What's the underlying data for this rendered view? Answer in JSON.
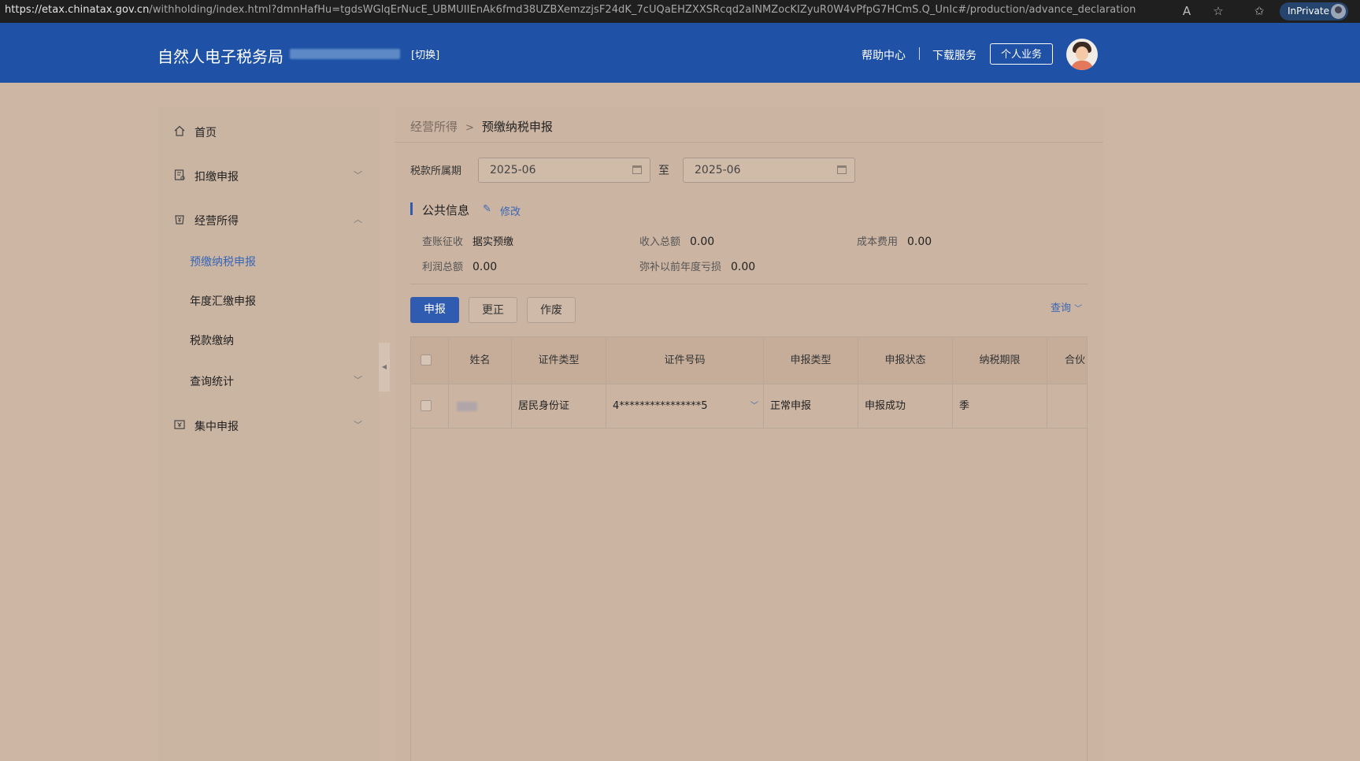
{
  "browser": {
    "url_host": "https://etax.chinatax.gov.cn",
    "url_path": "/withholding/index.html?dmnHafHu=tgdsWGlqErNucE_UBMUIIEnAk6fmd38UZBXemzzjsF24dK_7cUQaEHZXXSRcqd2aINMZocKIZyuR0W4vPfpG7HCmS.Q_UnIc#/production/advance_declaration",
    "inprivate_label": "InPrivate",
    "icons": [
      "read-aloud-icon",
      "star-icon",
      "favorites-icon"
    ]
  },
  "header": {
    "brand": "自然人电子税务局",
    "switch_label": "[切换]",
    "help": "帮助中心",
    "download": "下载服务",
    "personal": "个人业务"
  },
  "sidebar": {
    "items": [
      {
        "label": "首页",
        "icon": "home-icon"
      },
      {
        "label": "扣缴申报",
        "icon": "declare-icon"
      },
      {
        "label": "经营所得",
        "icon": "business-income-icon"
      },
      {
        "label": "集中申报",
        "icon": "central-declare-icon"
      }
    ],
    "subitems": [
      {
        "label": "预缴纳税申报",
        "active": true
      },
      {
        "label": "年度汇缴申报"
      },
      {
        "label": "税款缴纳"
      },
      {
        "label": "查询统计"
      }
    ]
  },
  "breadcrumb": {
    "parent": "经营所得",
    "current": "预缴纳税申报"
  },
  "period": {
    "label": "税款所属期",
    "from": "2025-06",
    "to_word": "至",
    "to": "2025-06"
  },
  "public_info": {
    "title": "公共信息",
    "edit": "修改",
    "fields": [
      {
        "k": "查账征收",
        "v": "据实预缴"
      },
      {
        "k": "收入总额",
        "v": "0.00"
      },
      {
        "k": "成本费用",
        "v": "0.00"
      },
      {
        "k": "利润总额",
        "v": "0.00"
      },
      {
        "k": "弥补以前年度亏损",
        "v": "0.00"
      }
    ]
  },
  "actions": {
    "declare": "申报",
    "correct": "更正",
    "void": "作废",
    "query": "查询"
  },
  "table": {
    "headers": [
      "姓名",
      "证件类型",
      "证件号码",
      "申报类型",
      "申报状态",
      "纳税期限",
      "合伙"
    ],
    "rows": [
      {
        "name": "",
        "id_type": "居民身份证",
        "id_number": "4****************5",
        "decl_type": "正常申报",
        "status": "申报成功",
        "period": "季",
        "partner": ""
      }
    ]
  },
  "colors": {
    "header": "#1f52a6",
    "accent": "#2f5bb0",
    "link": "#3a66b6"
  }
}
